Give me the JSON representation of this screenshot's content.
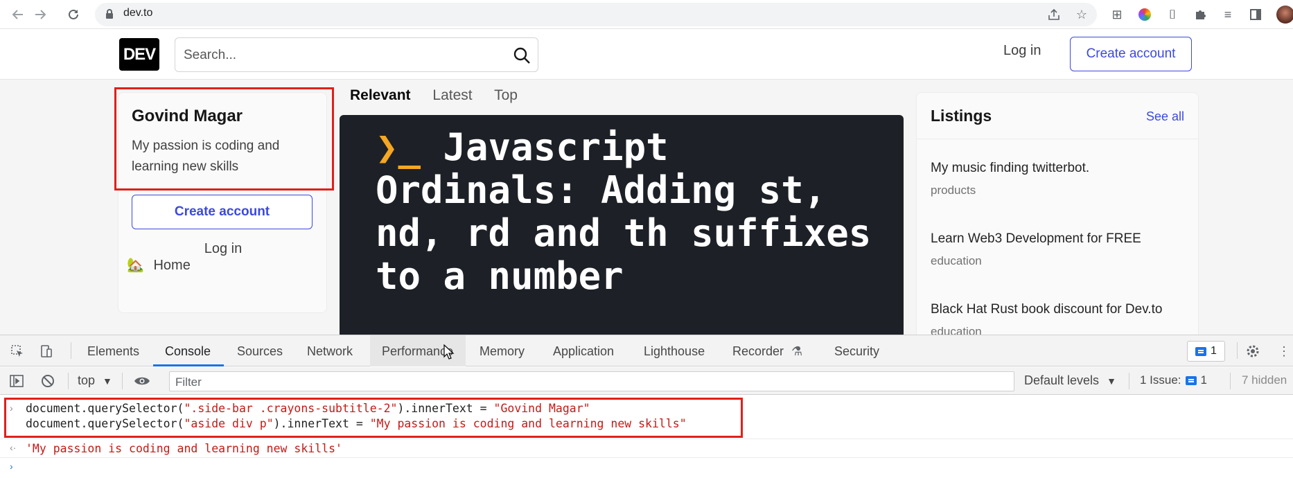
{
  "browser": {
    "url": "dev.to",
    "back_icon": "back-arrow-icon",
    "forward_icon": "forward-arrow-icon",
    "reload_icon": "reload-icon"
  },
  "site": {
    "logo": "DEV",
    "search_placeholder": "Search...",
    "login": "Log in",
    "create_account": "Create account",
    "profile": {
      "name": "Govind Magar",
      "bio": "My passion is coding and learning new skills"
    },
    "sidebar_create": "Create account",
    "sidebar_login": "Log in",
    "home": "Home",
    "home_icon": "🏡",
    "feed_tabs": [
      "Relevant",
      "Latest",
      "Top"
    ],
    "cover_prompt": "❯_",
    "cover_title": "Javascript Ordinals: Adding st, nd, rd and th suffixes to a number",
    "listings": {
      "title": "Listings",
      "see_all": "See all",
      "items": [
        {
          "title": "My music finding twitterbot.",
          "category": "products"
        },
        {
          "title": "Learn Web3 Development for FREE",
          "category": "education"
        },
        {
          "title": "Black Hat Rust book discount for Dev.to",
          "category": "education"
        }
      ]
    }
  },
  "devtools": {
    "tabs": [
      "Elements",
      "Console",
      "Sources",
      "Network",
      "Performance",
      "Memory",
      "Application",
      "Lighthouse",
      "Recorder",
      "Security"
    ],
    "active_tab": "Console",
    "issue_count": "1",
    "context": "top",
    "filter_placeholder": "Filter",
    "levels": "Default levels",
    "issues_label": "1 Issue:",
    "issues_count": "1",
    "hidden": "7 hidden",
    "console": {
      "line1_pre": "document.querySelector(",
      "line1_sel": "\".side-bar .crayons-subtitle-2\"",
      "line1_mid": ").innerText = ",
      "line1_val": "\"Govind Magar\"",
      "line2_pre": "document.querySelector(",
      "line2_sel": "\"aside div p\"",
      "line2_mid": ").innerText = ",
      "line2_val": "\"My passion is coding and learning new skills\"",
      "result": "'My passion is coding and learning new skills'"
    }
  }
}
